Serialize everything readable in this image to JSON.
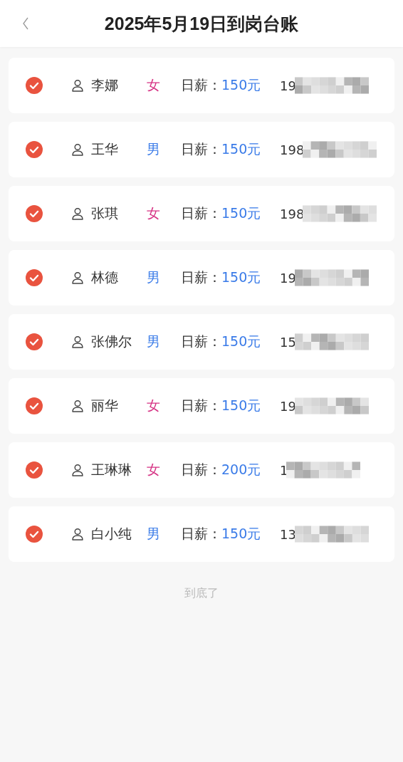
{
  "header": {
    "title": "2025年5月19日到岗台账"
  },
  "workers": [
    {
      "checked": true,
      "name": "李娜",
      "gender": "女",
      "color": "#d63384",
      "wage_label": "日薪：",
      "wage": "150元",
      "phone": "19"
    },
    {
      "checked": true,
      "name": "王华",
      "gender": "男",
      "color": "#3a7be8",
      "wage_label": "日薪：",
      "wage": "150元",
      "phone": "198"
    },
    {
      "checked": true,
      "name": "张琪",
      "gender": "女",
      "color": "#d63384",
      "wage_label": "日薪：",
      "wage": "150元",
      "phone": "198"
    },
    {
      "checked": true,
      "name": "林德",
      "gender": "男",
      "color": "#3a7be8",
      "wage_label": "日薪：",
      "wage": "150元",
      "phone": "19"
    },
    {
      "checked": true,
      "name": "张佛尔",
      "gender": "男",
      "color": "#3a7be8",
      "wage_label": "日薪：",
      "wage": "150元",
      "phone": "15"
    },
    {
      "checked": true,
      "name": "丽华",
      "gender": "女",
      "color": "#d63384",
      "wage_label": "日薪：",
      "wage": "150元",
      "phone": "19"
    },
    {
      "checked": true,
      "name": "王琳琳",
      "gender": "女",
      "color": "#d63384",
      "wage_label": "日薪：",
      "wage": "200元",
      "phone": "1"
    },
    {
      "checked": true,
      "name": "白小纯",
      "gender": "男",
      "color": "#3a7be8",
      "wage_label": "日薪：",
      "wage": "150元",
      "phone": "13"
    }
  ],
  "footer": {
    "text": "到底了"
  }
}
